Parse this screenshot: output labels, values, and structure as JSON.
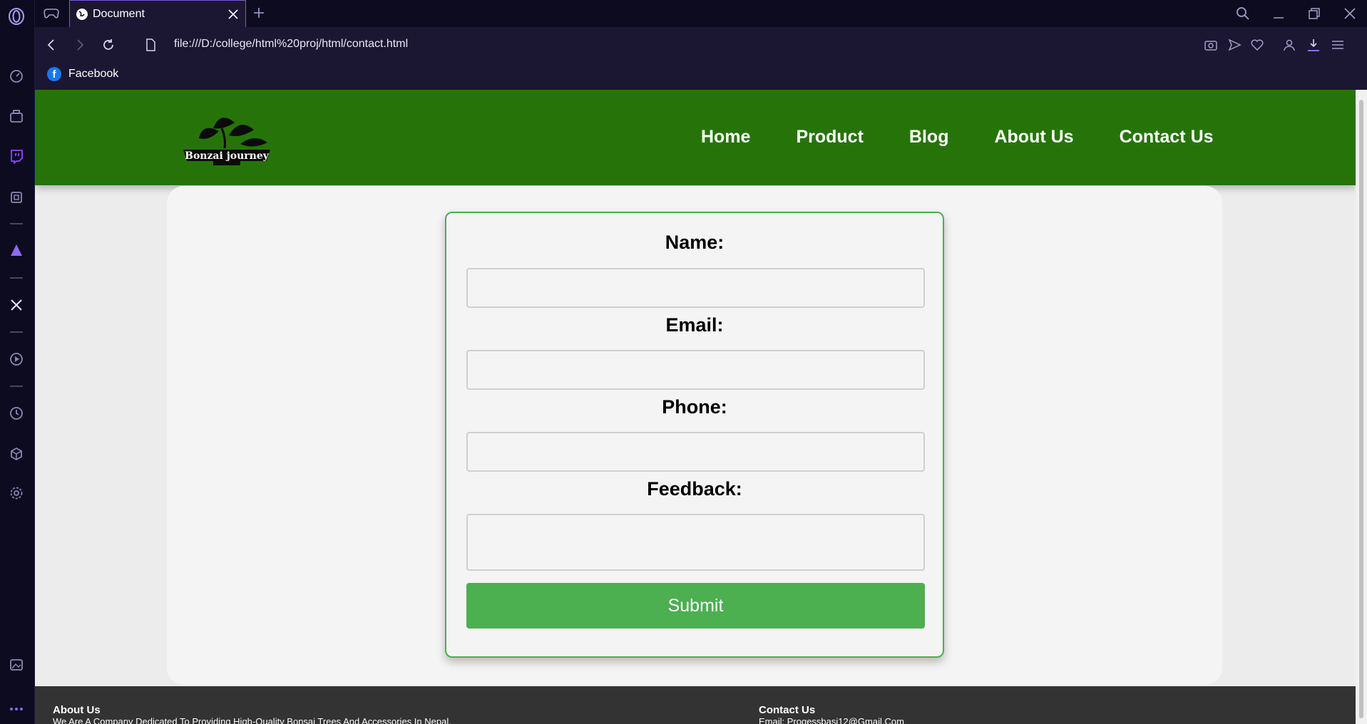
{
  "browser": {
    "tab_title": "Document",
    "url": "file:///D:/college/html%20proj/html/contact.html",
    "bookmark_facebook": "Facebook"
  },
  "site": {
    "logo_text": "Bonzai journey",
    "nav": [
      "Home",
      "Product",
      "Blog",
      "About Us",
      "Contact Us"
    ]
  },
  "form": {
    "name_label": "Name:",
    "email_label": "Email:",
    "phone_label": "Phone:",
    "feedback_label": "Feedback:",
    "submit_label": "Submit",
    "name_value": "",
    "email_value": "",
    "phone_value": "",
    "feedback_value": ""
  },
  "footer": {
    "about_title": "About Us",
    "about_text": "We Are A Company Dedicated To Providing High-Quality Bonsai Trees And Accessories In Nepal.",
    "contact_title": "Contact Us",
    "contact_text": "Email: Progessbasi12@Gmail.Com"
  },
  "colors": {
    "header_green": "#267409",
    "submit_green": "#4caf50",
    "browser_dark": "#0d0b1f",
    "accent_purple": "#7c5cd6"
  }
}
